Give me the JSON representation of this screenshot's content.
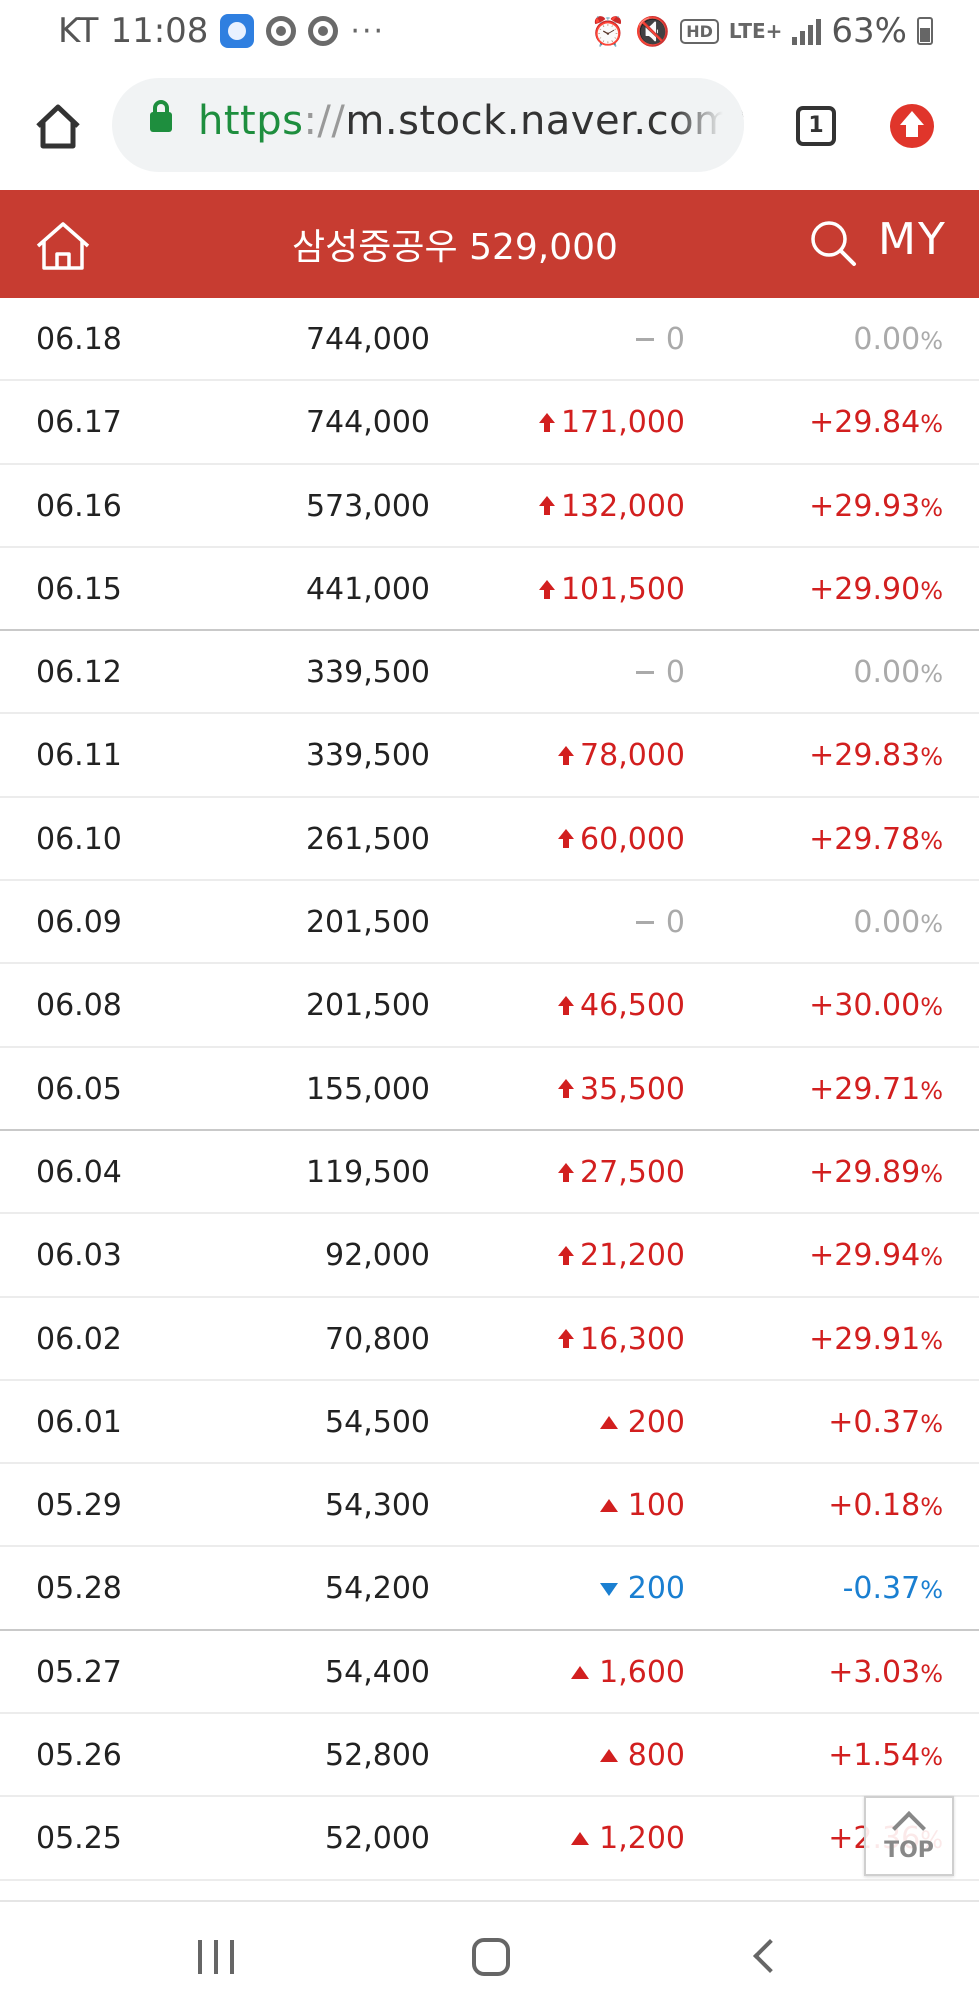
{
  "status_bar": {
    "carrier": "KT",
    "time": "11:08",
    "more": "···",
    "battery": "63%",
    "icons": [
      "app-icon",
      "chrome-icon",
      "chrome-icon",
      "alarm-icon",
      "mute-icon",
      "hd-voice-icon",
      "lte-icon",
      "signal-icon",
      "battery-icon"
    ],
    "hd_label": "HD",
    "lte_label": "LTE+"
  },
  "browser": {
    "url_scheme": "https",
    "url_sep": "://",
    "url_rest": "m.stock.naver.com/it",
    "tab_count": "1"
  },
  "header": {
    "title": "삼성중공우 529,000",
    "my_label": "MY"
  },
  "colors": {
    "header_red": "#c73c31",
    "rise": "#d21f1f",
    "fall": "#1a7fd1",
    "flat": "#aaaaaa",
    "secure_green": "#1e8e3e"
  },
  "table": {
    "rows": [
      {
        "date": "06.18",
        "close": "744,000",
        "change": "0",
        "rate": "0.00",
        "direction": "flat"
      },
      {
        "date": "06.17",
        "close": "744,000",
        "change": "171,000",
        "rate": "+29.84",
        "direction": "upper-limit"
      },
      {
        "date": "06.16",
        "close": "573,000",
        "change": "132,000",
        "rate": "+29.93",
        "direction": "upper-limit"
      },
      {
        "date": "06.15",
        "close": "441,000",
        "change": "101,500",
        "rate": "+29.90",
        "direction": "upper-limit"
      },
      {
        "date": "06.12",
        "close": "339,500",
        "change": "0",
        "rate": "0.00",
        "direction": "flat"
      },
      {
        "date": "06.11",
        "close": "339,500",
        "change": "78,000",
        "rate": "+29.83",
        "direction": "upper-limit"
      },
      {
        "date": "06.10",
        "close": "261,500",
        "change": "60,000",
        "rate": "+29.78",
        "direction": "upper-limit"
      },
      {
        "date": "06.09",
        "close": "201,500",
        "change": "0",
        "rate": "0.00",
        "direction": "flat"
      },
      {
        "date": "06.08",
        "close": "201,500",
        "change": "46,500",
        "rate": "+30.00",
        "direction": "upper-limit"
      },
      {
        "date": "06.05",
        "close": "155,000",
        "change": "35,500",
        "rate": "+29.71",
        "direction": "upper-limit"
      },
      {
        "date": "06.04",
        "close": "119,500",
        "change": "27,500",
        "rate": "+29.89",
        "direction": "upper-limit"
      },
      {
        "date": "06.03",
        "close": "92,000",
        "change": "21,200",
        "rate": "+29.94",
        "direction": "upper-limit"
      },
      {
        "date": "06.02",
        "close": "70,800",
        "change": "16,300",
        "rate": "+29.91",
        "direction": "upper-limit"
      },
      {
        "date": "06.01",
        "close": "54,500",
        "change": "200",
        "rate": "+0.37",
        "direction": "up"
      },
      {
        "date": "05.29",
        "close": "54,300",
        "change": "100",
        "rate": "+0.18",
        "direction": "up"
      },
      {
        "date": "05.28",
        "close": "54,200",
        "change": "200",
        "rate": "-0.37",
        "direction": "down"
      },
      {
        "date": "05.27",
        "close": "54,400",
        "change": "1,600",
        "rate": "+3.03",
        "direction": "up"
      },
      {
        "date": "05.26",
        "close": "52,800",
        "change": "800",
        "rate": "+1.54",
        "direction": "up"
      },
      {
        "date": "05.25",
        "close": "52,000",
        "change": "1,200",
        "rate": "+2.36",
        "direction": "up"
      }
    ],
    "percent_sign": "%"
  },
  "top_button": {
    "label": "TOP"
  },
  "nav": {
    "icons": [
      "recents-icon",
      "home-icon",
      "back-icon"
    ]
  }
}
